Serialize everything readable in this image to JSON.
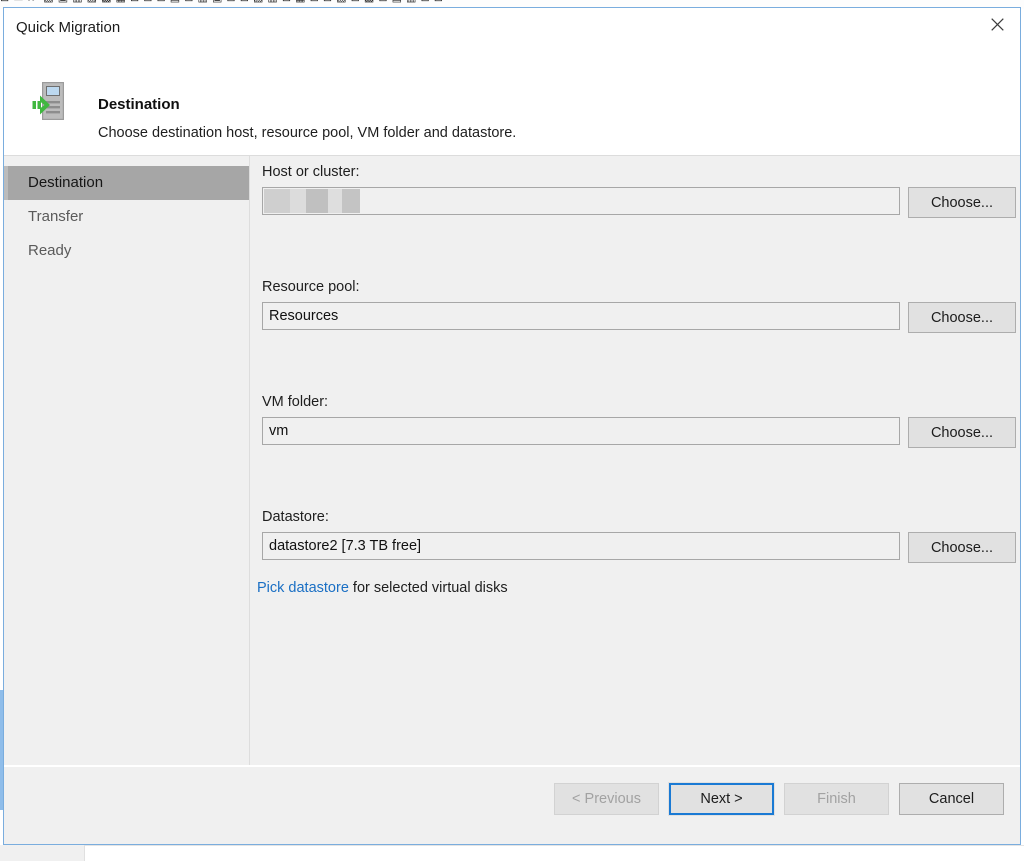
{
  "background": {
    "toolbar_glyphs": "⊞ ▭  ≫  ▧  ▣  ▥  ▨  ▩  ▦  ⊡    ⊞  ⊟    ▤  ⊠  ▥  ▣  ⊟  ⊞    ▨  ▥  ⊡  ▦    ⊞   ⊠    ▧  ⊡  ▩  ⊞  ▤  ▥  ⊟  ⊠",
    "accent_color": "#8fbdea"
  },
  "window": {
    "title": "Quick Migration",
    "close_icon": "close-icon"
  },
  "header": {
    "icon": "server-migrate-icon",
    "title": "Destination",
    "subtitle": "Choose destination host, resource pool, VM folder and datastore."
  },
  "sidebar": {
    "items": [
      {
        "label": "Destination",
        "selected": true
      },
      {
        "label": "Transfer",
        "selected": false
      },
      {
        "label": "Ready",
        "selected": false
      }
    ]
  },
  "form": {
    "choose_label": "Choose...",
    "fields": [
      {
        "name": "host-or-cluster",
        "label": "Host or cluster:",
        "value": "",
        "redacted": true
      },
      {
        "name": "resource-pool",
        "label": "Resource pool:",
        "value": "Resources",
        "redacted": false
      },
      {
        "name": "vm-folder",
        "label": "VM folder:",
        "value": "vm",
        "redacted": false
      },
      {
        "name": "datastore",
        "label": "Datastore:",
        "value": "datastore2 [7.3 TB free]",
        "redacted": false
      }
    ],
    "pick_datastore_link": "Pick datastore",
    "pick_datastore_suffix": "for selected virtual disks",
    "link_color": "#1a6fc4"
  },
  "footer": {
    "buttons": [
      {
        "label": "< Previous",
        "state": "disabled"
      },
      {
        "label": "Next >",
        "state": "default"
      },
      {
        "label": "Finish",
        "state": "disabled"
      },
      {
        "label": "Cancel",
        "state": "normal"
      }
    ]
  }
}
